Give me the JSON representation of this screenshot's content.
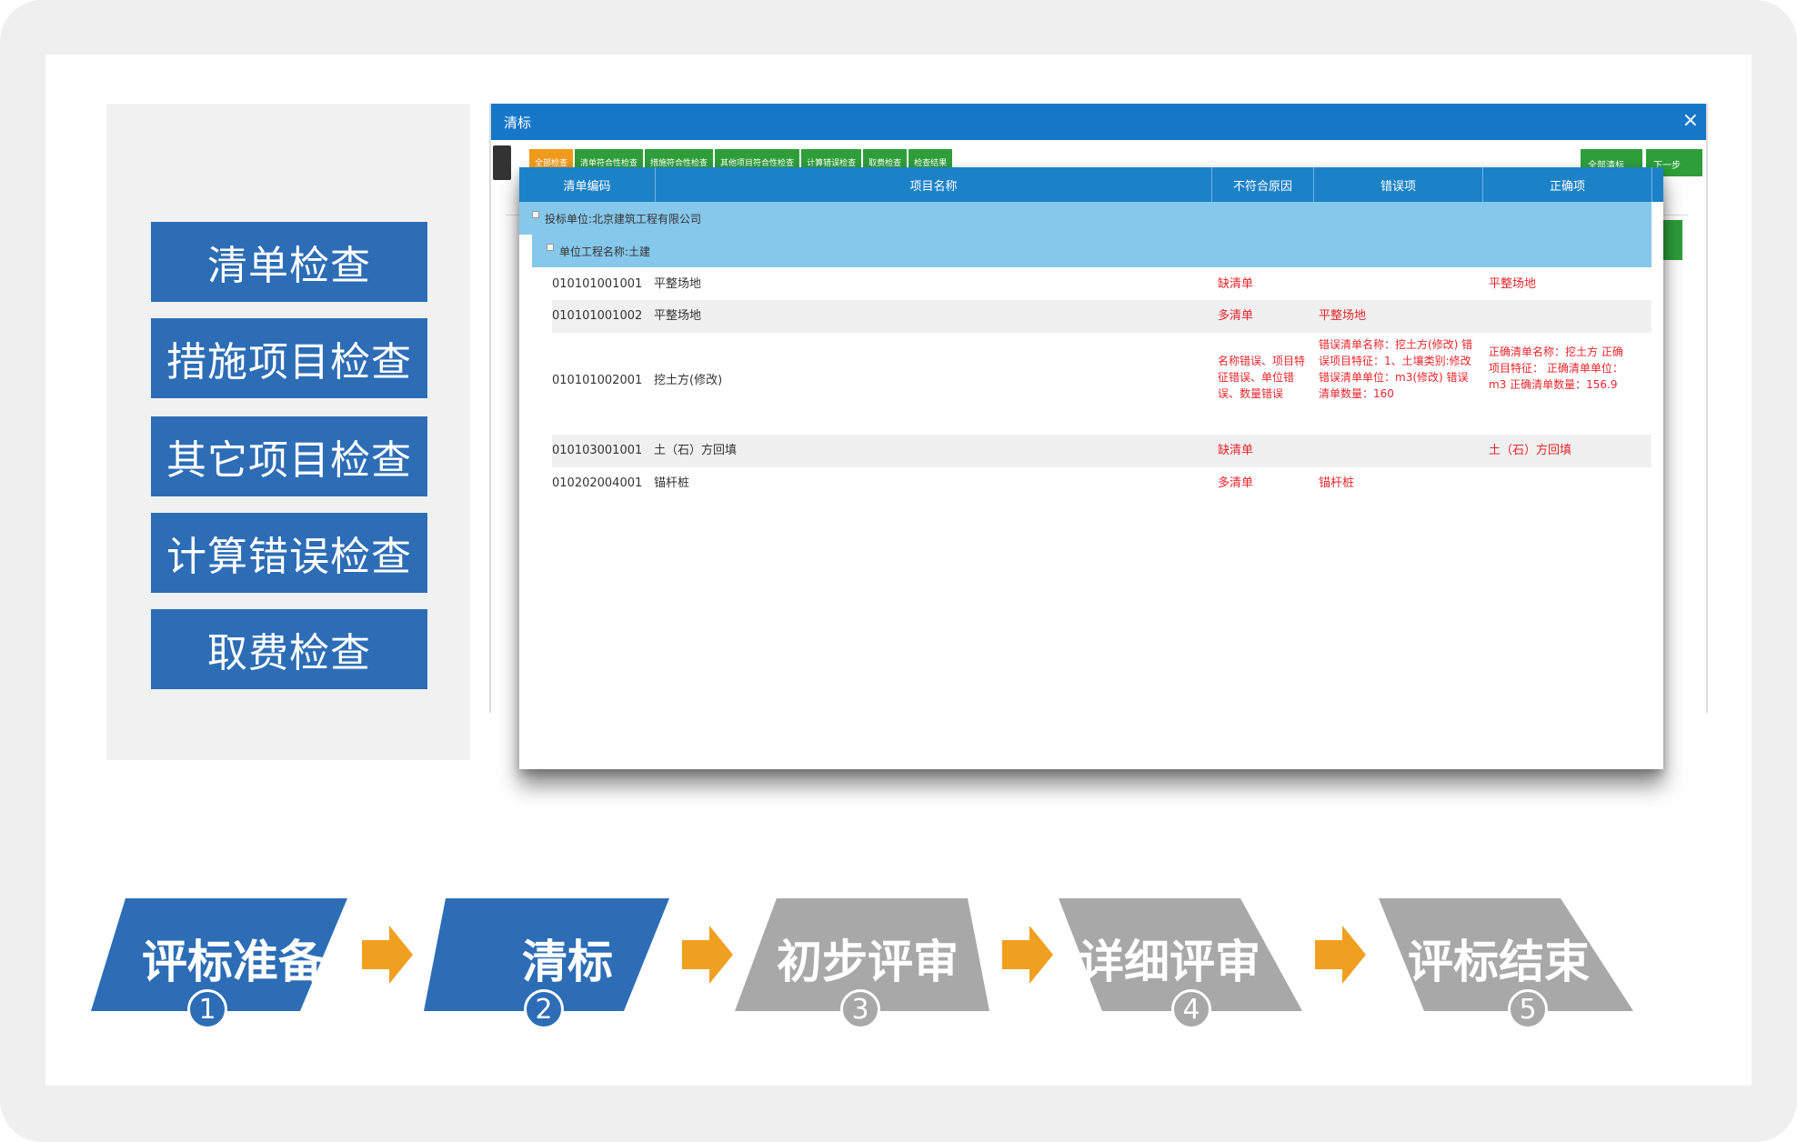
{
  "left_menu": [
    "清单检查",
    "措施项目检查",
    "其它项目检查",
    "计算错误检查",
    "取费检查"
  ],
  "app": {
    "title": "清标",
    "close_glyph": "×",
    "tabs": [
      "全部检查",
      "清单符合性检查",
      "措施符合性检查",
      "其他项目符合性检查",
      "计算错误检查",
      "取费检查",
      "检查结果"
    ],
    "right_buttons": [
      "全部清标",
      "下一步"
    ]
  },
  "popup": {
    "headers": [
      "清单编码",
      "项目名称",
      "不符合原因",
      "错误项",
      "正确项"
    ],
    "group1": "投标单位:北京建筑工程有限公司",
    "group2": "单位工程名称:土建",
    "rows": [
      {
        "code": "010101001001",
        "name": "平整场地",
        "reason": "缺清单",
        "wrong": "",
        "correct": "平整场地"
      },
      {
        "code": "010101001002",
        "name": "平整场地",
        "reason": "多清单",
        "wrong": "平整场地",
        "correct": ""
      },
      {
        "code": "010101002001",
        "name": "挖土方(修改)",
        "reason": "名称错误、项目特征错误、单位错误、数量错误",
        "wrong": "错误清单名称：挖土方(修改) 错误项目特征：1、土壤类别:修改 错误清单单位：m3(修改) 错误清单数量：160",
        "correct": "正确清单名称：挖土方 正确项目特征： 正确清单单位：m3 正确清单数量：156.9"
      },
      {
        "code": "010103001001",
        "name": "土（石）方回填",
        "reason": "缺清单",
        "wrong": "",
        "correct": "土（石）方回填"
      },
      {
        "code": "010202004001",
        "name": "锚杆桩",
        "reason": "多清单",
        "wrong": "锚杆桩",
        "correct": ""
      }
    ]
  },
  "steps": [
    {
      "label": "评标准备",
      "num": "1",
      "color": "#2d6db6"
    },
    {
      "label": "清标",
      "num": "2",
      "color": "#2d6db6"
    },
    {
      "label": "初步评审",
      "num": "3",
      "color": "#a8a8a8"
    },
    {
      "label": "详细评审",
      "num": "4",
      "color": "#a8a8a8"
    },
    {
      "label": "评标结束",
      "num": "5",
      "color": "#a8a8a8"
    }
  ],
  "colors": {
    "accent_blue": "#2d6db6",
    "arrow_orange": "#f0a020",
    "header_blue": "#1c82c8",
    "group_blue": "#86c8ec",
    "error_red": "#e8252b",
    "tab_green": "#2e9e3a"
  }
}
